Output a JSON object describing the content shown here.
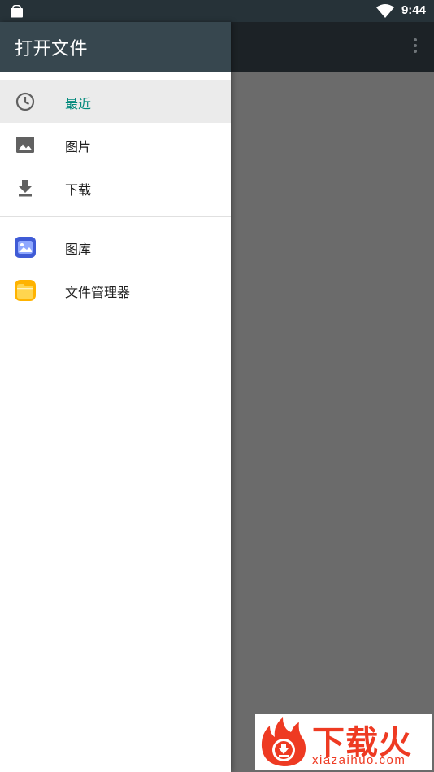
{
  "status_bar": {
    "time": "9:44"
  },
  "drawer": {
    "title": "打开文件",
    "items": [
      {
        "label": "最近",
        "icon": "clock-icon",
        "active": true
      },
      {
        "label": "图片",
        "icon": "image-icon",
        "active": false
      },
      {
        "label": "下载",
        "icon": "download-icon",
        "active": false
      }
    ],
    "apps": [
      {
        "label": "图库",
        "icon": "gallery-app-icon"
      },
      {
        "label": "文件管理器",
        "icon": "file-manager-app-icon"
      }
    ]
  },
  "watermark": {
    "brand": "下载火",
    "url": "xiazaihuo.com"
  },
  "colors": {
    "drawer_header": "#37474f",
    "status_bar": "#263238",
    "accent": "#00897b",
    "scrim": "#6b6b6b",
    "watermark_red": "#ee3a22"
  }
}
